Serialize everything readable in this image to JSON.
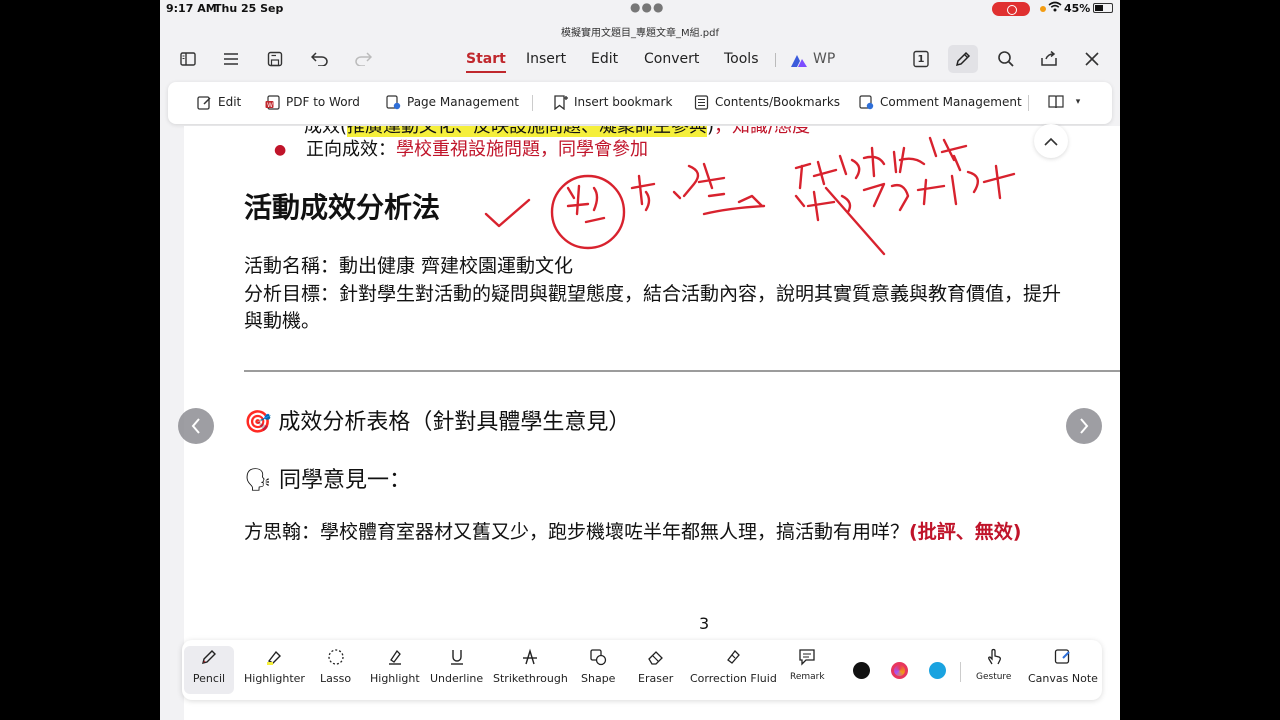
{
  "status": {
    "time": "9:17 AM",
    "date": "Thu 25 Sep",
    "battery": "45%"
  },
  "filename": "模擬實用文題目_專題文章_M組.pdf",
  "tabs": [
    {
      "label": "Start",
      "active": true
    },
    {
      "label": "Insert"
    },
    {
      "label": "Edit"
    },
    {
      "label": "Convert"
    },
    {
      "label": "Tools"
    },
    {
      "label": "WP"
    }
  ],
  "page_indicator": "1",
  "subtoolbar": [
    {
      "label": "Edit",
      "icon": "edit-icon"
    },
    {
      "label": "PDF to Word",
      "icon": "pdf-to-word-icon"
    },
    {
      "label": "Page Management",
      "icon": "page-management-icon"
    },
    {
      "label": "Insert bookmark",
      "icon": "bookmark-icon"
    },
    {
      "label": "Contents/Bookmarks",
      "icon": "contents-icon"
    },
    {
      "label": "Comment Management",
      "icon": "comment-icon"
    }
  ],
  "doc": {
    "line_partial_a": "成效(",
    "line_partial_hl": "推廣運動文化、反映設施問題、凝聚師生參與",
    "line_partial_b": ")",
    "line_partial_red": "，知識/態度",
    "bullet_prefix": "正向成效：",
    "bullet_red": "學校重視設施問題，同學會參加",
    "heading": "活動成效分析法",
    "activity_name": "活動名稱：動出健康 齊建校園運動文化",
    "analysis_goal": "分析目標：針對學生對活動的疑問與觀望態度，結合活動內容，說明其實質意義與教育價值，提升",
    "analysis_goal_cont": "與動機。",
    "table_heading_icon": "🎯",
    "table_heading": "成效分析表格（針對具體學生意見）",
    "opinion_icon": "🗣",
    "opinion_heading": "同學意見一：",
    "opinion_text": "方思翰：學校體育室器材又舊又少，跑步機壞咗半年都無人理，搞活動有用咩？",
    "opinion_tag": "(批評、無效)",
    "page_number": "3"
  },
  "tools": [
    {
      "label": "Pencil",
      "icon": "pencil-icon",
      "active": true
    },
    {
      "label": "Highlighter",
      "icon": "highlighter-icon"
    },
    {
      "label": "Lasso",
      "icon": "lasso-icon"
    },
    {
      "label": "Highlight",
      "icon": "highlight-icon"
    },
    {
      "label": "Underline",
      "icon": "underline-icon"
    },
    {
      "label": "Strikethrough",
      "icon": "strikethrough-icon"
    },
    {
      "label": "Shape",
      "icon": "shape-icon"
    },
    {
      "label": "Eraser",
      "icon": "eraser-icon"
    },
    {
      "label": "Correction Fluid",
      "icon": "correction-fluid-icon"
    },
    {
      "label": "Remark",
      "icon": "remark-icon"
    },
    {
      "label": "Gesture",
      "icon": "gesture-icon"
    },
    {
      "label": "Canvas Note",
      "icon": "canvas-note-icon"
    }
  ],
  "colors": {
    "accent": "#c0282d",
    "ink": "#d8222e",
    "swatch_black": "#111111",
    "swatch_multi": "#e8365d",
    "swatch_blue": "#1aa3e0",
    "highlight": "#f5ef3b"
  }
}
